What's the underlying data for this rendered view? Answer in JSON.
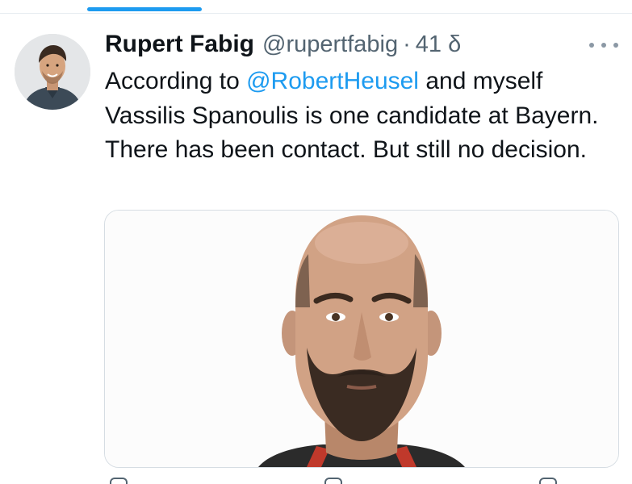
{
  "tweet": {
    "display_name": "Rupert Fabig",
    "handle": "@rupertfabig",
    "separator": "·",
    "time": "41 δ",
    "text_before_mention": "According to ",
    "mention": "@RobertHeusel",
    "text_after_mention": " and myself Vassilis Spanoulis is one candidate at Bayern. There has been contact. But still no decision."
  },
  "icons": {
    "more": "more-horizontal-icon",
    "reply": "reply-icon",
    "retweet": "retweet-icon",
    "like": "like-icon",
    "share": "share-icon"
  },
  "colors": {
    "accent": "#1d9bf0",
    "secondary_text": "#536471",
    "primary_text": "#0f1419"
  }
}
